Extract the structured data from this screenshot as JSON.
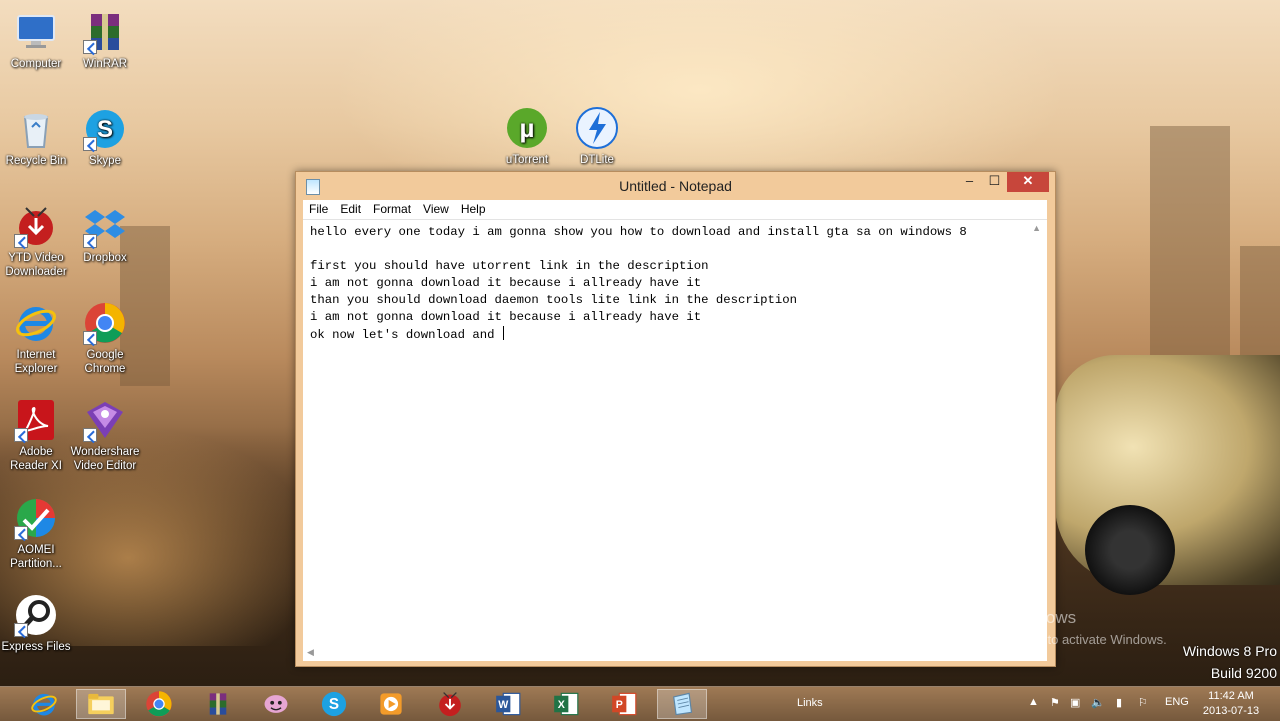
{
  "desktop": {
    "icons": [
      {
        "label": "Computer",
        "icon": "computer-icon"
      },
      {
        "label": "WinRAR",
        "icon": "winrar-icon"
      },
      {
        "label": "Recycle Bin",
        "icon": "recycle-bin-icon"
      },
      {
        "label": "Skype",
        "icon": "skype-icon"
      },
      {
        "label": "YTD Video Downloader",
        "icon": "ytd-icon"
      },
      {
        "label": "Dropbox",
        "icon": "dropbox-icon"
      },
      {
        "label": "Internet Explorer",
        "icon": "ie-icon"
      },
      {
        "label": "Google Chrome",
        "icon": "chrome-icon"
      },
      {
        "label": "Adobe Reader XI",
        "icon": "adobe-reader-icon"
      },
      {
        "label": "Wondershare Video Editor",
        "icon": "wondershare-icon"
      },
      {
        "label": "AOMEI Partition...",
        "icon": "aomei-icon"
      },
      {
        "label": "Express Files",
        "icon": "express-files-icon"
      },
      {
        "label": "uTorrent",
        "icon": "utorrent-icon"
      },
      {
        "label": "DTLite",
        "icon": "dtlite-icon"
      }
    ],
    "activate_title": "Activate Windows",
    "activate_sub": "Go to PC settings to activate Windows.",
    "edition": "Windows 8 Pro",
    "build": "Build 9200"
  },
  "notepad": {
    "title": "Untitled - Notepad",
    "buttons": {
      "minimize": "–",
      "maximize": "☐",
      "close": "✕"
    },
    "menu": [
      "File",
      "Edit",
      "Format",
      "View",
      "Help"
    ],
    "text": "hello every one today i am gonna show you how to download and install gta sa on windows 8\n\nfirst you should have utorrent link in the description\ni am not gonna download it because i allready have it\nthan you should download daemon tools lite link in the description\ni am not gonna download it because i allready have it\nok now let's download and "
  },
  "taskbar": {
    "apps": [
      "internet-explorer",
      "file-explorer",
      "chrome",
      "winrar",
      "app-5",
      "skype",
      "media-player",
      "ytd",
      "word",
      "excel",
      "powerpoint",
      "notepad"
    ],
    "links_label": "Links",
    "language": "ENG",
    "time": "11:42 AM",
    "date": "2013-07-13"
  },
  "colors": {
    "close_button": "#c7463b",
    "window_frame": "#f2ca9b",
    "taskbar": "#8a6440"
  }
}
